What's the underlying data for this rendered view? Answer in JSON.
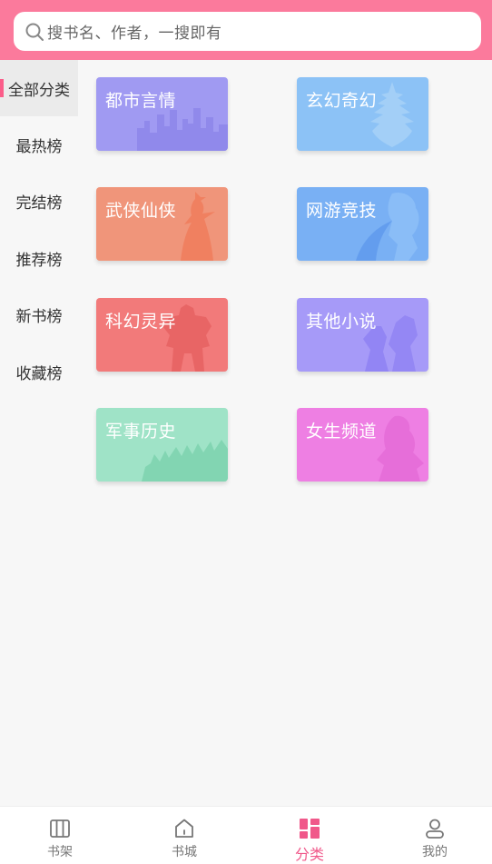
{
  "search": {
    "placeholder": "搜书名、作者，一搜即有"
  },
  "sidebar": {
    "items": [
      {
        "label": "全部分类",
        "active": true
      },
      {
        "label": "最热榜"
      },
      {
        "label": "完结榜"
      },
      {
        "label": "推荐榜"
      },
      {
        "label": "新书榜"
      },
      {
        "label": "收藏榜"
      }
    ]
  },
  "categories": [
    {
      "label": "都市言情",
      "color": "#a09af2"
    },
    {
      "label": "玄幻奇幻",
      "color": "#8cc2f6"
    },
    {
      "label": "武侠仙侠",
      "color": "#f0957a"
    },
    {
      "label": "网游竞技",
      "color": "#79b0f4"
    },
    {
      "label": "科幻灵异",
      "color": "#f27a7a"
    },
    {
      "label": "其他小说",
      "color": "#a69af8"
    },
    {
      "label": "军事历史",
      "color": "#9fe3c7"
    },
    {
      "label": "女生频道",
      "color": "#ee7fe3"
    }
  ],
  "tabbar": {
    "items": [
      {
        "label": "书架",
        "icon": "bookshelf-icon"
      },
      {
        "label": "书城",
        "icon": "home-icon"
      },
      {
        "label": "分类",
        "icon": "category-grid-icon",
        "active": true
      },
      {
        "label": "我的",
        "icon": "user-icon"
      }
    ]
  },
  "colors": {
    "accent": "#fb7a9c",
    "active_tab": "#f0588a"
  }
}
